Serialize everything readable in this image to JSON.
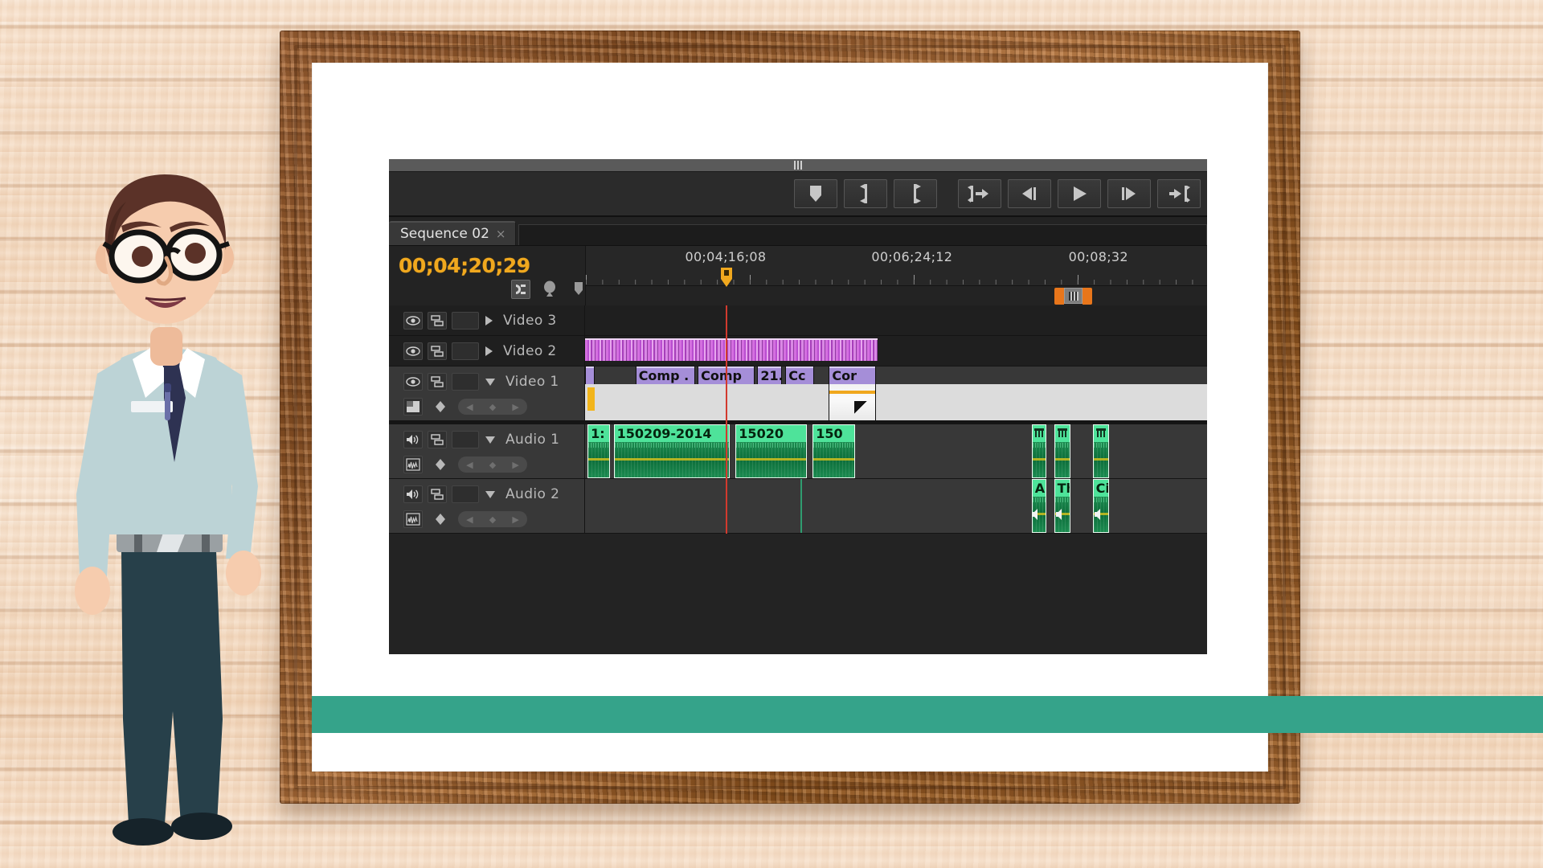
{
  "scene": {
    "description": "Cartoon presenter beside a wooden picture frame displaying an Adobe Premiere Pro timeline panel",
    "wood_background_color": "#f2d8bf",
    "frame_color": "#8f5527",
    "matte_color": "#ffffff",
    "teal_band_color": "#35a38a"
  },
  "character": {
    "name": "presenter-character",
    "hair_color": "#5b3228",
    "skin_color": "#f6ccae",
    "glasses_color": "#141414",
    "shirt_color": "#bcd3d6",
    "tie_color": "#2e3252",
    "belt_color": "#9aa0a3",
    "pants_color": "#27404a",
    "shoe_color": "#16232a"
  },
  "panel": {
    "toolbar_buttons": [
      {
        "name": "marker-button",
        "icon": "marker-pin-icon"
      },
      {
        "name": "mark-in-button",
        "icon": "mark-in-icon"
      },
      {
        "name": "mark-out-button",
        "icon": "mark-out-icon"
      },
      {
        "name": "go-to-in-button",
        "icon": "go-to-in-icon"
      },
      {
        "name": "step-back-button",
        "icon": "step-back-icon"
      },
      {
        "name": "play-stop-toggle-button",
        "icon": "play-icon"
      },
      {
        "name": "step-forward-button",
        "icon": "step-forward-icon"
      },
      {
        "name": "go-to-out-button",
        "icon": "go-to-out-icon"
      }
    ],
    "tab": {
      "label": "Sequence 02",
      "close": "×"
    },
    "timecode": "00;04;20;29",
    "header_icons": [
      {
        "name": "snap-toggle",
        "icon": "snap-magnet-icon",
        "active": true
      },
      {
        "name": "add-marker",
        "icon": "marker-balloon-icon",
        "active": false
      },
      {
        "name": "marker-tool",
        "icon": "marker-pin-icon",
        "active": false
      }
    ],
    "ruler": {
      "labels": [
        "00;04;16;08",
        "00;06;24;12",
        "00;08;32"
      ],
      "label_positions_pct": [
        22.5,
        52.5,
        82.5
      ]
    },
    "tracks": [
      {
        "name": "Video 3",
        "type": "video",
        "expanded": false,
        "controls": [
          "toggle-track-output",
          "toggle-sync-lock"
        ],
        "clips": []
      },
      {
        "name": "Video 2",
        "type": "video",
        "expanded": false,
        "controls": [
          "toggle-track-output",
          "toggle-sync-lock"
        ],
        "clips": [
          {
            "label": "",
            "style": "stripes",
            "left_pct": 0.0,
            "width_pct": 47.0
          }
        ]
      },
      {
        "name": "Video 1",
        "type": "video",
        "expanded": true,
        "controls": [
          "toggle-track-output",
          "toggle-sync-lock",
          "video-track-display",
          "keyframe-nav"
        ],
        "clips": [
          {
            "label": "",
            "style": "thin",
            "left_pct": 0.6,
            "width_pct": 1.6
          },
          {
            "label": "",
            "style": "thin",
            "left_pct": 2.6,
            "width_pct": 2.6
          },
          {
            "label": "",
            "style": "thin",
            "left_pct": 5.6,
            "width_pct": 2.0
          },
          {
            "label": "Comp .",
            "style": "doc",
            "left_pct": 8.1,
            "width_pct": 9.6
          },
          {
            "label": "Comp",
            "style": "green",
            "left_pct": 18.1,
            "width_pct": 9.2
          },
          {
            "label": "21.",
            "style": "greenplain",
            "left_pct": 27.7,
            "width_pct": 4.0
          },
          {
            "label": "Cc",
            "style": "blueobj",
            "left_pct": 32.2,
            "width_pct": 4.6
          },
          {
            "label": "",
            "style": "thin",
            "left_pct": 37.2,
            "width_pct": 1.6
          },
          {
            "label": "Cor",
            "style": "docflag",
            "left_pct": 39.2,
            "width_pct": 7.6
          }
        ]
      },
      {
        "name": "Audio 1",
        "type": "audio",
        "expanded": true,
        "controls": [
          "mute-track",
          "toggle-sync-lock",
          "audio-track-display",
          "keyframe-nav"
        ],
        "clips": [
          {
            "label": "1:",
            "style": "wave",
            "left_pct": 0.4,
            "width_pct": 3.6
          },
          {
            "label": "150209-2014",
            "style": "wave",
            "left_pct": 4.6,
            "width_pct": 18.6
          },
          {
            "label": "15020",
            "style": "wave",
            "left_pct": 24.2,
            "width_pct": 11.4
          },
          {
            "label": "150",
            "style": "wave",
            "left_pct": 36.6,
            "width_pct": 6.8
          },
          {
            "label": "",
            "style": "music-icon",
            "left_pct": 71.8,
            "width_pct": 2.4
          },
          {
            "label": "",
            "style": "music-icon",
            "left_pct": 75.4,
            "width_pct": 2.6
          },
          {
            "label": "",
            "style": "music-icon",
            "left_pct": 81.6,
            "width_pct": 2.6
          }
        ]
      },
      {
        "name": "Audio 2",
        "type": "audio",
        "expanded": true,
        "controls": [
          "mute-track",
          "toggle-sync-lock",
          "audio-track-display",
          "keyframe-nav"
        ],
        "clips": [
          {
            "label": "A",
            "style": "wave-spk",
            "left_pct": 71.8,
            "width_pct": 2.4
          },
          {
            "label": "Th",
            "style": "wave-spk",
            "left_pct": 75.4,
            "width_pct": 2.6
          },
          {
            "label": "Ci",
            "style": "wave-spk",
            "left_pct": 81.6,
            "width_pct": 2.6
          }
        ]
      }
    ],
    "playhead_pct": 22.6,
    "workarea": {
      "left_pct": 77.0,
      "width_pct": 3.0
    },
    "colors": {
      "panel_bg": "#232323",
      "track_bg": "#383838",
      "timecode": "#f0a81e",
      "playhead": "#d23a2e",
      "video_clip": "#a58ed8",
      "audio_clip": "#4ee39a",
      "workarea_handle": "#e8761b"
    }
  }
}
